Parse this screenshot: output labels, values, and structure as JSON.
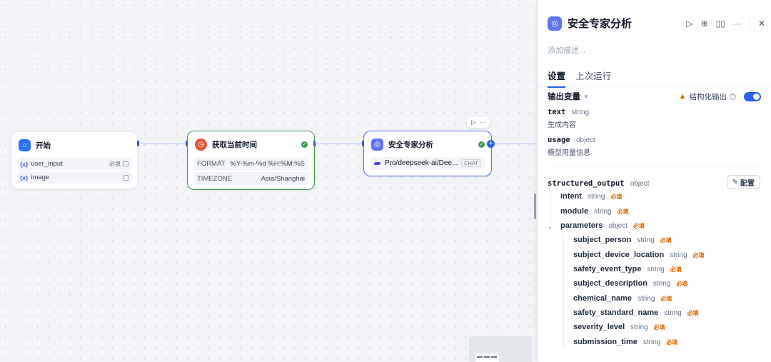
{
  "canvas": {
    "nodes": {
      "start": {
        "title": "开始",
        "icon": "home-icon",
        "vars": [
          {
            "name": "user_input",
            "required": "必填",
            "icon": "text-input-icon"
          },
          {
            "name": "image",
            "required": "",
            "icon": "file-icon"
          }
        ]
      },
      "time": {
        "title": "获取当前时间",
        "icon": "clock-icon",
        "params": [
          {
            "key": "FORMAT",
            "value": "%Y-%m-%d %H:%M:%S"
          },
          {
            "key": "TIMEZONE",
            "value": "Asia/Shanghai"
          }
        ]
      },
      "llm": {
        "title": "安全专家分析",
        "icon": "llm-brain-icon",
        "model": "Pro/deepseek-ai/Dee...",
        "mode_tag": "CHAT"
      }
    },
    "var_prefix": "{x}",
    "node_toolbar": {
      "run_icon": "▷",
      "more_icon": "···"
    },
    "add_icon": "+"
  },
  "panel": {
    "title": "安全专家分析",
    "description_placeholder": "添加描述...",
    "actions": [
      "run-icon",
      "target-icon",
      "book-icon",
      "more-icon",
      "close-icon"
    ],
    "tabs": [
      {
        "label": "设置",
        "active": true
      },
      {
        "label": "上次运行",
        "active": false
      }
    ],
    "output": {
      "label": "输出变量",
      "structured_label": "结构化输出",
      "structured_enabled": true,
      "vars": [
        {
          "name": "text",
          "type": "string",
          "desc": "生成内容"
        },
        {
          "name": "usage",
          "type": "object",
          "desc": "模型用量信息"
        }
      ]
    },
    "structured": {
      "name": "structured_output",
      "type": "object",
      "config_label": "配置",
      "fields": [
        {
          "name": "intent",
          "type": "string",
          "required": "必填"
        },
        {
          "name": "module",
          "type": "string",
          "required": "必填"
        },
        {
          "name": "parameters",
          "type": "object",
          "required": "必填"
        }
      ],
      "sub_fields": [
        {
          "name": "subject_person",
          "type": "string",
          "required": "必填"
        },
        {
          "name": "subject_device_location",
          "type": "string",
          "required": "必填"
        },
        {
          "name": "safety_event_type",
          "type": "string",
          "required": "必填"
        },
        {
          "name": "subject_description",
          "type": "string",
          "required": "必填"
        },
        {
          "name": "chemical_name",
          "type": "string",
          "required": "必填"
        },
        {
          "name": "safety_standard_name",
          "type": "string",
          "required": "必填"
        },
        {
          "name": "severity_level",
          "type": "string",
          "required": "必填"
        },
        {
          "name": "submission_time",
          "type": "string",
          "required": "必填"
        }
      ]
    }
  },
  "colors": {
    "accent": "#2563eb",
    "start_icon": "#2970ff",
    "time_icon": "#e0573a",
    "llm_icon": "#6172f3",
    "success": "#3f9c52",
    "warning": "#dc6803"
  }
}
